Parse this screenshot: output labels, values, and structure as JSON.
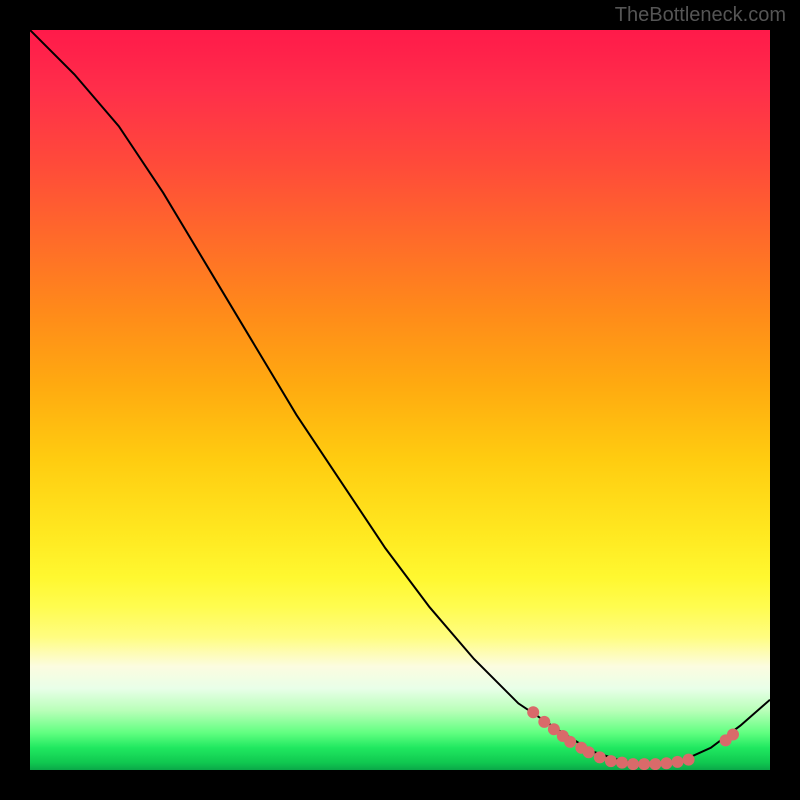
{
  "watermark": "TheBottleneck.com",
  "chart_data": {
    "type": "line",
    "title": "",
    "xlabel": "",
    "ylabel": "",
    "curve": [
      {
        "x": 0.0,
        "y": 1.0
      },
      {
        "x": 0.06,
        "y": 0.94
      },
      {
        "x": 0.12,
        "y": 0.87
      },
      {
        "x": 0.18,
        "y": 0.78
      },
      {
        "x": 0.24,
        "y": 0.68
      },
      {
        "x": 0.3,
        "y": 0.58
      },
      {
        "x": 0.36,
        "y": 0.48
      },
      {
        "x": 0.42,
        "y": 0.39
      },
      {
        "x": 0.48,
        "y": 0.3
      },
      {
        "x": 0.54,
        "y": 0.22
      },
      {
        "x": 0.6,
        "y": 0.15
      },
      {
        "x": 0.66,
        "y": 0.09
      },
      {
        "x": 0.72,
        "y": 0.05
      },
      {
        "x": 0.76,
        "y": 0.025
      },
      {
        "x": 0.8,
        "y": 0.012
      },
      {
        "x": 0.84,
        "y": 0.008
      },
      {
        "x": 0.88,
        "y": 0.012
      },
      {
        "x": 0.92,
        "y": 0.03
      },
      {
        "x": 0.96,
        "y": 0.06
      },
      {
        "x": 1.0,
        "y": 0.095
      }
    ],
    "markers": [
      {
        "x": 0.68,
        "y": 0.078
      },
      {
        "x": 0.695,
        "y": 0.065
      },
      {
        "x": 0.708,
        "y": 0.055
      },
      {
        "x": 0.72,
        "y": 0.046
      },
      {
        "x": 0.73,
        "y": 0.038
      },
      {
        "x": 0.745,
        "y": 0.03
      },
      {
        "x": 0.755,
        "y": 0.024
      },
      {
        "x": 0.77,
        "y": 0.017
      },
      {
        "x": 0.785,
        "y": 0.012
      },
      {
        "x": 0.8,
        "y": 0.01
      },
      {
        "x": 0.815,
        "y": 0.008
      },
      {
        "x": 0.83,
        "y": 0.008
      },
      {
        "x": 0.845,
        "y": 0.008
      },
      {
        "x": 0.86,
        "y": 0.009
      },
      {
        "x": 0.875,
        "y": 0.011
      },
      {
        "x": 0.89,
        "y": 0.014
      },
      {
        "x": 0.94,
        "y": 0.04
      },
      {
        "x": 0.95,
        "y": 0.048
      }
    ],
    "gradient_stops": [
      {
        "pos": 0.0,
        "color": "#ff1a4a"
      },
      {
        "pos": 0.5,
        "color": "#ffcc10"
      },
      {
        "pos": 0.8,
        "color": "#fffc50"
      },
      {
        "pos": 0.95,
        "color": "#60ff80"
      },
      {
        "pos": 1.0,
        "color": "#0aa848"
      }
    ]
  }
}
